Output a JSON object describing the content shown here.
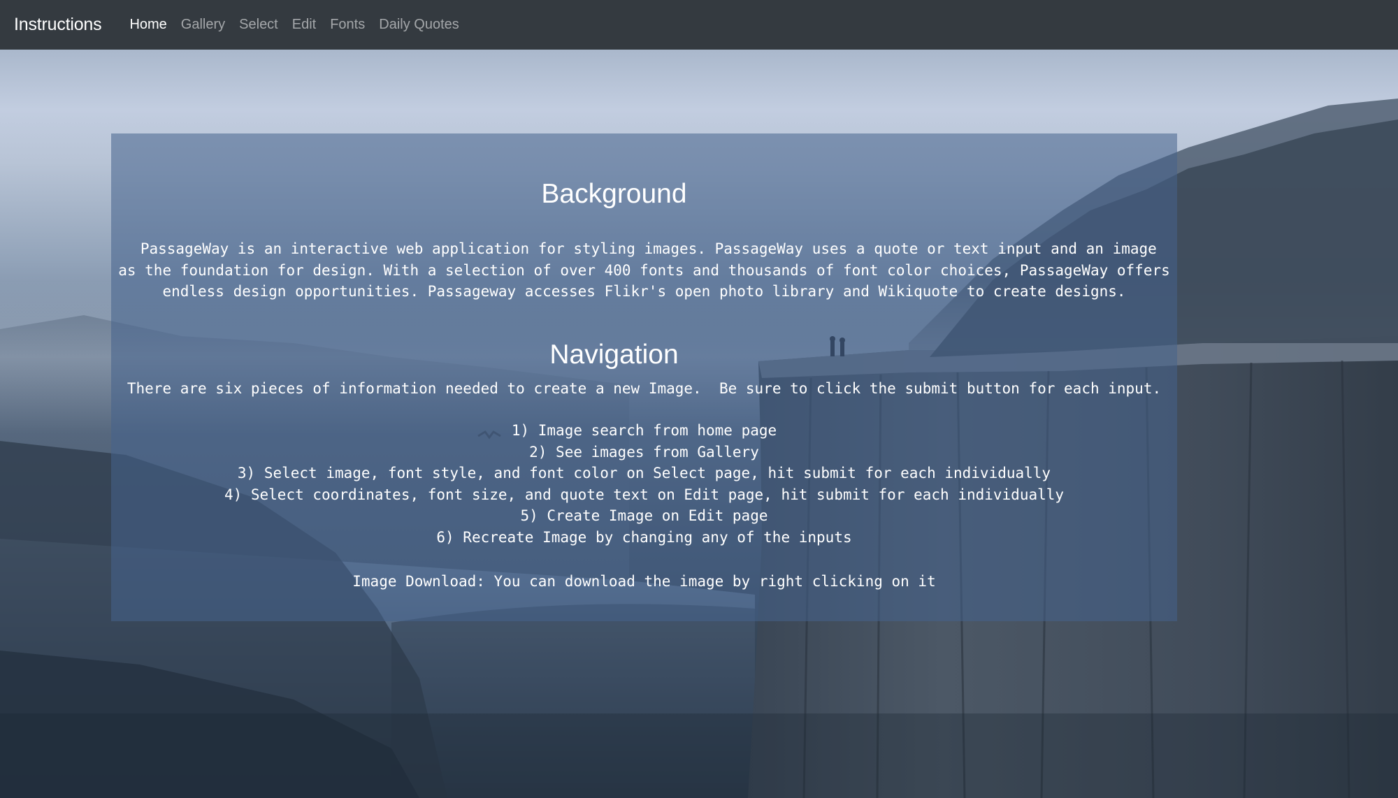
{
  "navbar": {
    "brand": "Instructions",
    "links": [
      {
        "label": "Home",
        "active": true
      },
      {
        "label": "Gallery",
        "active": false
      },
      {
        "label": "Select",
        "active": false
      },
      {
        "label": "Edit",
        "active": false
      },
      {
        "label": "Fonts",
        "active": false
      },
      {
        "label": "Daily Quotes",
        "active": false
      }
    ]
  },
  "background_section": {
    "heading": "Background",
    "lines": [
      " PassageWay is an interactive web application for styling images. PassageWay uses a quote or text input and an image",
      "as the foundation for design. With a selection of over 400 fonts and thousands of font color choices, PassageWay offers",
      "endless design opportunities. Passageway accesses Flikr's open photo library and Wikiquote to create designs."
    ]
  },
  "navigation_section": {
    "heading": "Navigation",
    "intro": "There are six pieces of information needed to create a new Image.  Be sure to click the submit button for each input.",
    "steps": [
      "1) Image search from home page",
      "2) See images from Gallery",
      "3) Select image, font style, and font color on Select page, hit submit for each individually",
      "4) Select coordinates, font size, and quote text on Edit page, hit submit for each individually",
      "5) Create Image on Edit page",
      "6) Recreate Image by changing any of the inputs"
    ],
    "download_note": "Image Download: You can download the image by right clicking on it"
  },
  "colors": {
    "navbar_bg": "#343a40",
    "panel_bg": "rgba(70,98,140,0.55)",
    "text": "#ffffff"
  }
}
